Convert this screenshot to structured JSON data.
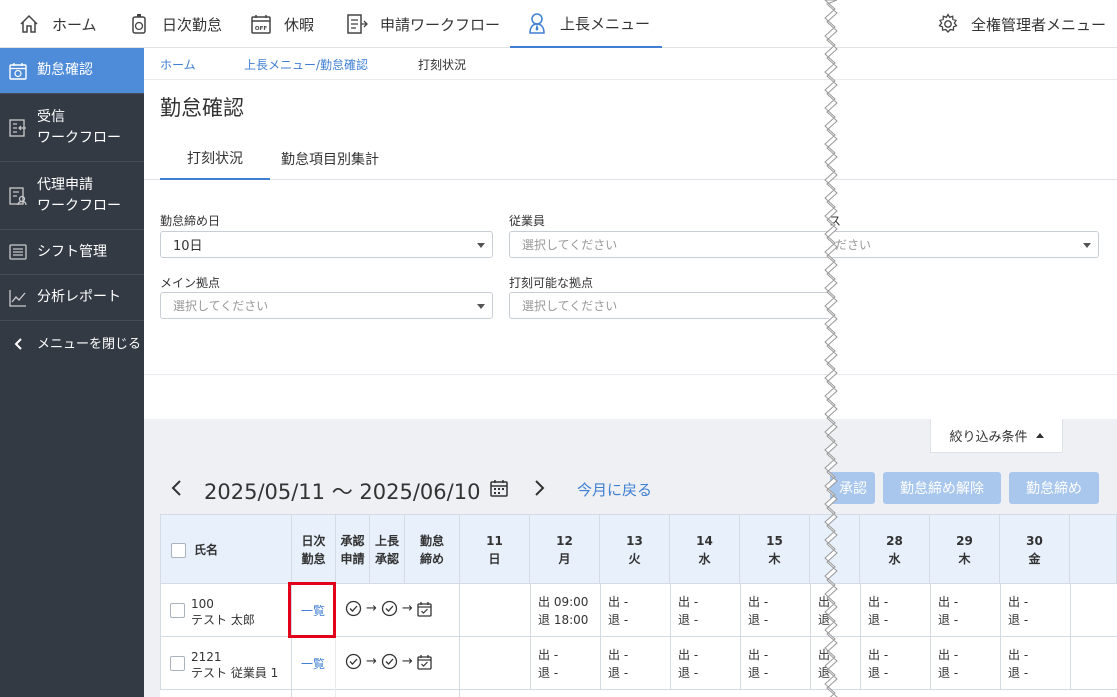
{
  "top_nav": {
    "home": "ホーム",
    "daily": "日次勤怠",
    "leave": "休暇",
    "workflow": "申請ワークフロー",
    "manager_menu": "上長メニュー",
    "admin_menu": "全権管理者メニュー"
  },
  "sidebar": {
    "items": [
      {
        "label": "勤怠確認",
        "icon": "calendar-check-icon"
      },
      {
        "label": "受信\nワークフロー",
        "icon": "inbox-list-icon"
      },
      {
        "label": "代理申請\nワークフロー",
        "icon": "proxy-list-icon"
      },
      {
        "label": "シフト管理",
        "icon": "shift-board-icon"
      },
      {
        "label": "分析レポート",
        "icon": "line-chart-icon"
      },
      {
        "label": "メニューを閉じる",
        "icon": "chevron-left-icon"
      }
    ]
  },
  "breadcrumb": {
    "home": "ホーム",
    "parent": "上長メニュー/勤怠確認",
    "current": "打刻状況"
  },
  "page": {
    "title": "勤怠確認",
    "tabs": [
      "打刻状況",
      "勤怠項目別集計"
    ]
  },
  "filters": {
    "closing_day_label": "勤怠締め日",
    "closing_day_value": "10日",
    "employee_label": "従業員",
    "employee_placeholder": "選択してください",
    "third_label_fragment": "ス",
    "third_placeholder_fragment": "ださい",
    "main_location_label": "メイン拠点",
    "main_location_placeholder": "選択してください",
    "punch_location_label": "打刻可能な拠点",
    "punch_location_placeholder": "選択してください",
    "filter_toggle": "絞り込み条件"
  },
  "period": {
    "range": "2025/05/11 〜 2025/06/10",
    "back_to_month": "今月に戻る"
  },
  "actions": {
    "approve_fragment": "承認",
    "close_release": "勤怠締め解除",
    "close": "勤怠締め"
  },
  "table": {
    "headers": {
      "name": "氏名",
      "daily": [
        "日次",
        "勤怠"
      ],
      "approval_req": [
        "承認",
        "申請"
      ],
      "manager_approval": [
        "上長",
        "承認"
      ],
      "closing": [
        "勤怠",
        "締め"
      ]
    },
    "days": [
      {
        "date": "11",
        "dow": "日"
      },
      {
        "date": "12",
        "dow": "月"
      },
      {
        "date": "13",
        "dow": "火"
      },
      {
        "date": "14",
        "dow": "水"
      },
      {
        "date": "15",
        "dow": "木"
      },
      {
        "date": "",
        "dow": ""
      },
      {
        "date": "28",
        "dow": "水"
      },
      {
        "date": "29",
        "dow": "木"
      },
      {
        "date": "30",
        "dow": "金"
      }
    ],
    "rows": [
      {
        "id": "100",
        "name": "テスト 太郎",
        "daily_link": "一覧",
        "punches": [
          [
            "",
            ""
          ],
          [
            "出 09:00",
            "退 18:00"
          ],
          [
            "出 -",
            "退 -"
          ],
          [
            "出 -",
            "退 -"
          ],
          [
            "出 -",
            "退 -"
          ],
          [
            "出",
            "退"
          ],
          [
            "出 -",
            "退 -"
          ],
          [
            "出 -",
            "退 -"
          ],
          [
            "出 -",
            "退 -"
          ]
        ]
      },
      {
        "id": "2121",
        "name": "テスト 従業員 1",
        "daily_link": "一覧",
        "punches": [
          [
            "",
            ""
          ],
          [
            "出 -",
            "退 -"
          ],
          [
            "出 -",
            "退 -"
          ],
          [
            "出 -",
            "退 -"
          ],
          [
            "出 -",
            "退 -"
          ],
          [
            "出",
            "退"
          ],
          [
            "出 -",
            "退 -"
          ],
          [
            "出 -",
            "退 -"
          ],
          [
            "出 -",
            "退 -"
          ]
        ]
      }
    ],
    "arrow": "→"
  },
  "colors": {
    "accent": "#3f7fd3",
    "sidebar_bg": "#333a44",
    "sidebar_active": "#4e8bd8",
    "highlight": "#e3001b",
    "button_disabled": "#a9c7ec"
  }
}
